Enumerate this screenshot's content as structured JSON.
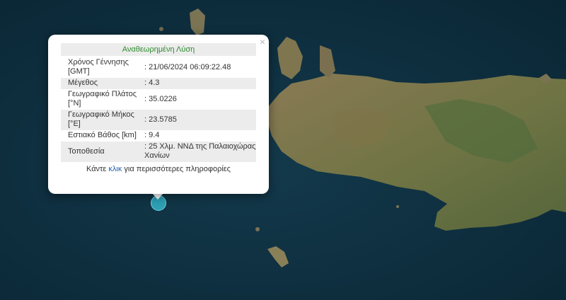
{
  "popup": {
    "title": "Αναθεωρημένη Λύση",
    "close_symbol": "×",
    "rows": [
      {
        "label": "Χρόνος Γέννησης [GMT]",
        "value": ": 21/06/2024 06:09:22.48"
      },
      {
        "label": "Μέγεθος",
        "value": ": 4.3"
      },
      {
        "label": "Γεωγραφικό Πλάτος [°N]",
        "value": ": 35.0226"
      },
      {
        "label": "Γεωγραφικό Μήκος [°E]",
        "value": ": 23.5785"
      },
      {
        "label": "Εστιακό Βάθος [km]",
        "value": ": 9.4"
      },
      {
        "label": "Τοποθεσία",
        "value": ": 25 Χλμ. ΝΝΔ της Παλαιοχώρας Χανίων"
      }
    ],
    "more_prefix": "Κάντε ",
    "more_link": "κλικ",
    "more_suffix": " για περισσότερες πληροφορίες"
  },
  "marker": {
    "icon": "earthquake-marker",
    "color": "#2e9fb4"
  }
}
